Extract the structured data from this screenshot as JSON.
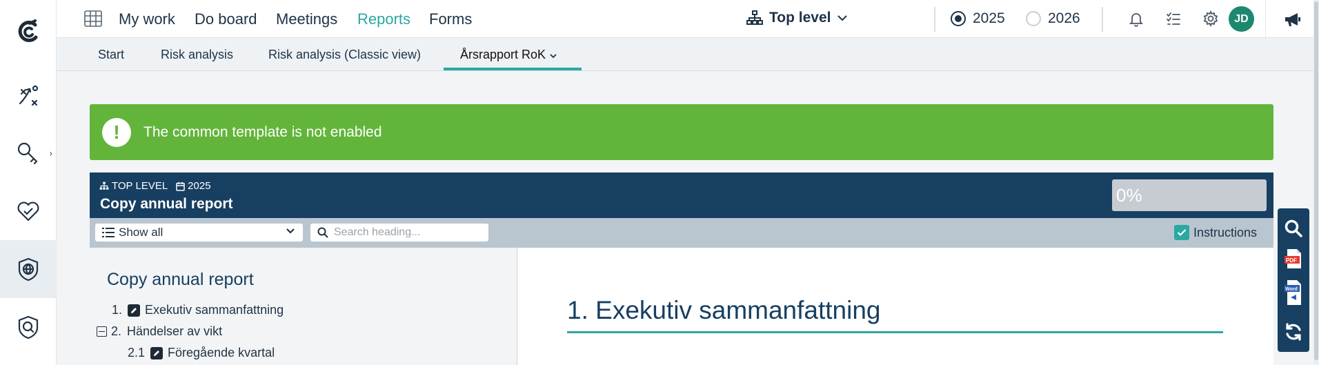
{
  "topnav": {
    "links": [
      "My work",
      "Do board",
      "Meetings",
      "Reports",
      "Forms"
    ],
    "org_unit": "Top level",
    "years": [
      "2025",
      "2026"
    ],
    "avatar_initials": "JD"
  },
  "subtabs": {
    "items": [
      "Start",
      "Risk analysis",
      "Risk analysis (Classic view)",
      "Årsrapport RoK"
    ]
  },
  "alert": {
    "icon": "!",
    "message": "The common template is not enabled"
  },
  "report": {
    "unit": "TOP LEVEL",
    "year": "2025",
    "title": "Copy annual report",
    "progress": "0%"
  },
  "toolbar": {
    "filter_value": "Show all",
    "search_placeholder": "Search heading...",
    "instructions_label": "Instructions"
  },
  "toc": {
    "title": "Copy annual report",
    "items": [
      {
        "num": "1.",
        "label": "Exekutiv sammanfattning"
      },
      {
        "num": "2.",
        "label": "Händelser av vikt"
      },
      {
        "num": "2.1",
        "label": "Föregående kvartal"
      }
    ]
  },
  "content": {
    "heading": "1. Exekutiv sammanfattning"
  },
  "colors": {
    "brand_teal": "#2aa8a1",
    "navy": "#173f61",
    "alert_green": "#62b53a"
  },
  "icons": [
    "logo-icon",
    "strategy-icon",
    "key-icon",
    "heart-icon",
    "shield-globe-icon",
    "search-shield-icon",
    "grid-icon",
    "org-chart-icon",
    "bell-icon",
    "tasks-icon",
    "gear-icon",
    "megaphone-icon",
    "search-icon",
    "pdf-icon",
    "word-icon",
    "refresh-icon"
  ]
}
